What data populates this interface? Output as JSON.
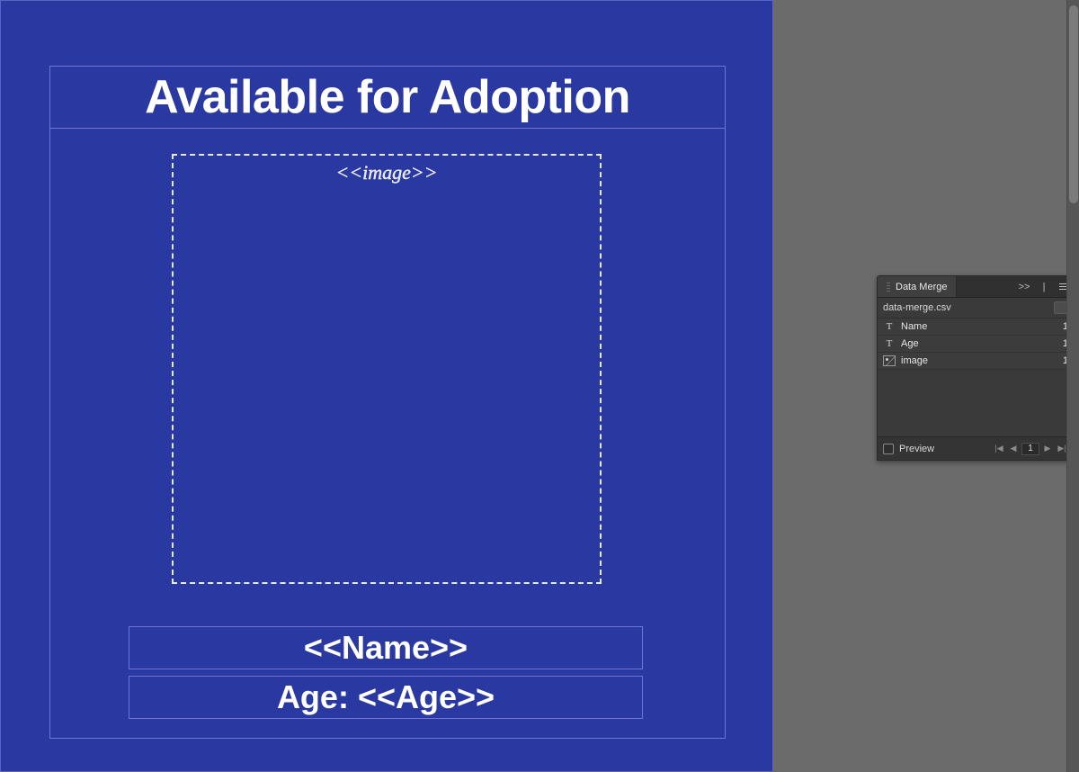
{
  "document": {
    "title": "Available for Adoption",
    "image_placeholder": "<<image>>",
    "name_line": "<<Name>>",
    "age_line": "Age: <<Age>>"
  },
  "panel": {
    "tab_label": "Data Merge",
    "collapse_glyph": ">>",
    "source_file": "data-merge.csv",
    "fields": [
      {
        "icon": "T",
        "label": "Name",
        "count": "1"
      },
      {
        "icon": "T",
        "label": "Age",
        "count": "1"
      },
      {
        "icon": "img",
        "label": "image",
        "count": "1"
      }
    ],
    "preview_label": "Preview",
    "pager": {
      "first": "|◀",
      "prev": "◀",
      "value": "1",
      "next": "▶",
      "last": "▶|"
    }
  }
}
